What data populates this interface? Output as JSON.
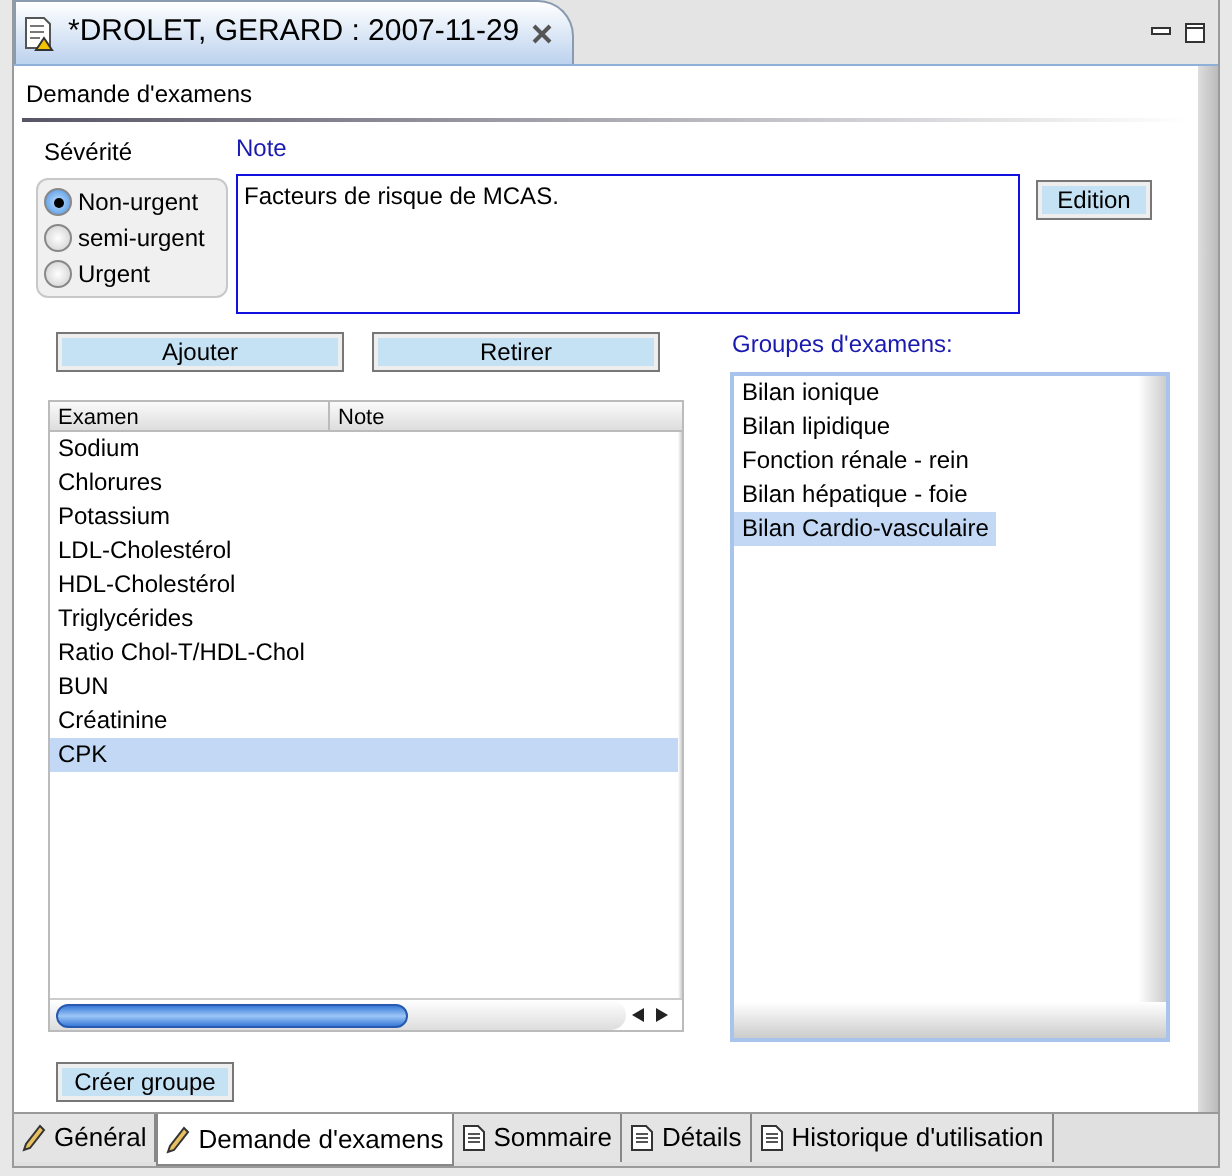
{
  "editor": {
    "title": "*DROLET, GERARD : 2007-11-29"
  },
  "section_title": "Demande d'examens",
  "severity": {
    "label": "Sévérité",
    "options": [
      {
        "label": "Non-urgent",
        "selected": true
      },
      {
        "label": "semi-urgent",
        "selected": false
      },
      {
        "label": "Urgent",
        "selected": false
      }
    ]
  },
  "note": {
    "label": "Note",
    "value": "Facteurs de risque de MCAS."
  },
  "buttons": {
    "edition": "Edition",
    "add": "Ajouter",
    "remove": "Retirer",
    "create_group": "Créer groupe"
  },
  "table": {
    "columns": [
      "Examen",
      "Note"
    ],
    "rows": [
      {
        "examen": "Sodium",
        "selected": false
      },
      {
        "examen": "Chlorures",
        "selected": false
      },
      {
        "examen": "Potassium",
        "selected": false
      },
      {
        "examen": "LDL-Cholestérol",
        "selected": false
      },
      {
        "examen": "HDL-Cholestérol",
        "selected": false
      },
      {
        "examen": "Triglycérides",
        "selected": false
      },
      {
        "examen": "Ratio Chol-T/HDL-Chol",
        "selected": false
      },
      {
        "examen": "BUN",
        "selected": false
      },
      {
        "examen": "Créatinine",
        "selected": false
      },
      {
        "examen": "CPK",
        "selected": true
      }
    ]
  },
  "groups": {
    "label": "Groupes d'examens:",
    "items": [
      {
        "label": "Bilan ionique",
        "selected": false
      },
      {
        "label": "Bilan lipidique",
        "selected": false
      },
      {
        "label": "Fonction rénale - rein",
        "selected": false
      },
      {
        "label": "Bilan hépatique - foie",
        "selected": false
      },
      {
        "label": "Bilan Cardio-vasculaire",
        "selected": true
      }
    ]
  },
  "bottom_tabs": [
    {
      "label": "Général",
      "kind": "pencil",
      "selected": false
    },
    {
      "label": "Demande d'examens",
      "kind": "pencil",
      "selected": true
    },
    {
      "label": "Sommaire",
      "kind": "document",
      "selected": false
    },
    {
      "label": "Détails",
      "kind": "document",
      "selected": false
    },
    {
      "label": "Historique d'utilisation",
      "kind": "document",
      "selected": false
    }
  ]
}
